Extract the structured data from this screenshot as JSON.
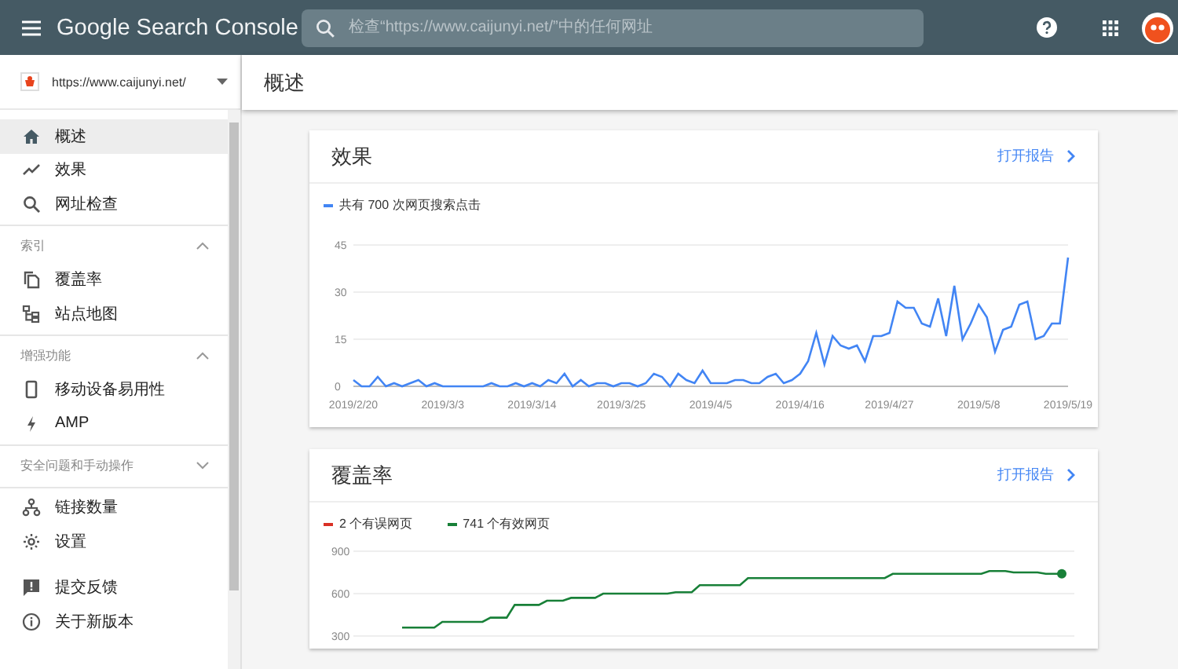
{
  "header": {
    "product": "Google Search Console",
    "search": {
      "placeholder": "检查“https://www.caijunyi.net/”中的任何网址"
    }
  },
  "sidebar": {
    "site": {
      "url": "https://www.caijunyi.net/"
    },
    "groups": [
      {
        "items": [
          {
            "label": "概述",
            "kind": "home",
            "selected": true
          },
          {
            "label": "效果",
            "kind": "trend",
            "selected": false
          },
          {
            "label": "网址检查",
            "kind": "search",
            "selected": false
          }
        ]
      },
      {
        "title": "索引",
        "expanded": true,
        "items": [
          {
            "label": "覆盖率",
            "kind": "copy",
            "selected": false
          },
          {
            "label": "站点地图",
            "kind": "sitemap",
            "selected": false
          }
        ]
      },
      {
        "title": "增强功能",
        "expanded": true,
        "items": [
          {
            "label": "移动设备易用性",
            "kind": "phone",
            "selected": false
          },
          {
            "label": "AMP",
            "kind": "bolt",
            "selected": false
          }
        ]
      },
      {
        "title": "安全问题和手动操作",
        "expanded": false
      },
      {
        "items": [
          {
            "label": "链接数量",
            "kind": "links",
            "selected": false
          },
          {
            "label": "设置",
            "kind": "gear",
            "selected": false
          }
        ]
      },
      {
        "items": [
          {
            "label": "提交反馈",
            "kind": "feedback",
            "selected": false
          },
          {
            "label": "关于新版本",
            "kind": "info",
            "selected": false
          }
        ]
      }
    ]
  },
  "page": {
    "title": "概述"
  },
  "cards": [
    {
      "title": "效果",
      "link": "打开报告",
      "chart_data": {
        "type": "line",
        "ylim": [
          0,
          45
        ],
        "yticks": [
          0,
          15,
          30,
          45
        ],
        "categories": [
          "2019/2/20",
          null,
          null,
          null,
          null,
          null,
          null,
          null,
          null,
          null,
          null,
          "2019/3/3",
          null,
          null,
          null,
          null,
          null,
          null,
          null,
          null,
          null,
          null,
          "2019/3/14",
          null,
          null,
          null,
          null,
          null,
          null,
          null,
          null,
          null,
          null,
          "2019/3/25",
          null,
          null,
          null,
          null,
          null,
          null,
          null,
          null,
          null,
          null,
          "2019/4/5",
          null,
          null,
          null,
          null,
          null,
          null,
          null,
          null,
          null,
          null,
          "2019/4/16",
          null,
          null,
          null,
          null,
          null,
          null,
          null,
          null,
          null,
          null,
          "2019/4/27",
          null,
          null,
          null,
          null,
          null,
          null,
          null,
          null,
          null,
          null,
          "2019/5/8",
          null,
          null,
          null,
          null,
          null,
          null,
          null,
          null,
          null,
          null,
          "2019/5/19"
        ],
        "series": [
          {
            "name": "共有 700 次网页搜索点击",
            "color": "#4285f4",
            "values": [
              2,
              0,
              0,
              3,
              0,
              1,
              0,
              1,
              2,
              0,
              1,
              0,
              0,
              0,
              0,
              0,
              0,
              1,
              0,
              0,
              1,
              0,
              1,
              0,
              2,
              1,
              4,
              0,
              2,
              0,
              1,
              1,
              0,
              1,
              1,
              0,
              1,
              4,
              3,
              0,
              4,
              2,
              1,
              5,
              1,
              1,
              1,
              2,
              2,
              1,
              1,
              3,
              4,
              1,
              2,
              4,
              8,
              17,
              7,
              16,
              13,
              12,
              13,
              8,
              16,
              16,
              17,
              27,
              25,
              25,
              20,
              19,
              28,
              16,
              32,
              15,
              20,
              26,
              22,
              11,
              18,
              19,
              26,
              27,
              15,
              16,
              20,
              20,
              41
            ]
          }
        ]
      }
    },
    {
      "title": "覆盖率",
      "link": "打开报告",
      "legend": [
        {
          "label": "2 个有误网页",
          "color": "#d93025"
        }
      ],
      "chart_data": {
        "type": "line",
        "ylim": [
          300,
          900
        ],
        "yticks": [
          300,
          600,
          900
        ],
        "series": [
          {
            "name": "741 个有效网页",
            "color": "#188038",
            "values": [
              360,
              360,
              360,
              360,
              360,
              400,
              400,
              400,
              400,
              400,
              400,
              430,
              430,
              430,
              520,
              520,
              520,
              520,
              550,
              550,
              550,
              570,
              570,
              570,
              570,
              600,
              600,
              600,
              600,
              600,
              600,
              600,
              600,
              600,
              610,
              610,
              610,
              660,
              660,
              660,
              660,
              660,
              660,
              710,
              710,
              710,
              710,
              710,
              710,
              710,
              710,
              710,
              710,
              710,
              710,
              710,
              710,
              710,
              710,
              710,
              710,
              740,
              740,
              740,
              740,
              740,
              740,
              740,
              740,
              740,
              740,
              740,
              740,
              760,
              760,
              760,
              750,
              750,
              750,
              750,
              740,
              740,
              740
            ]
          }
        ]
      }
    }
  ]
}
